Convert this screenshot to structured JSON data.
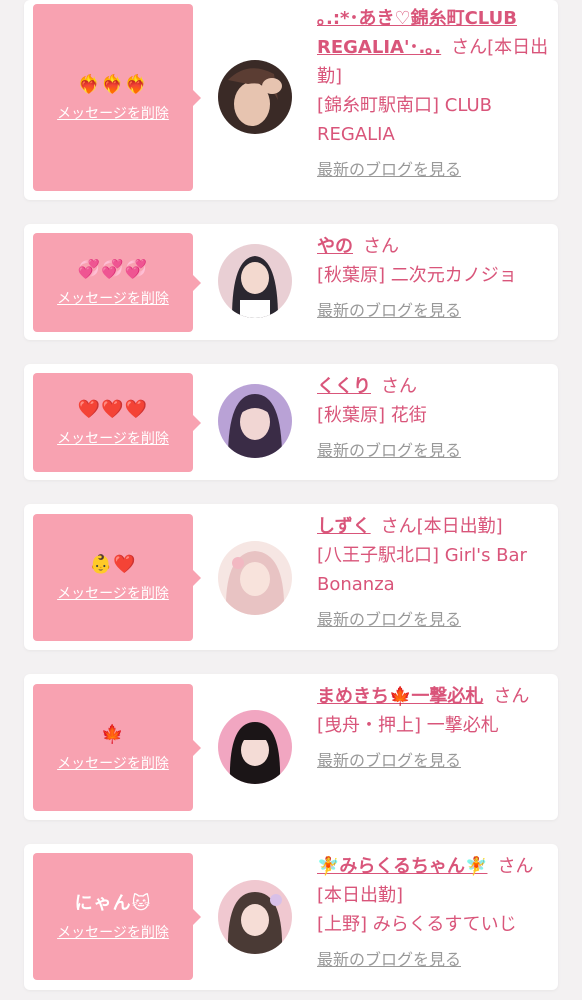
{
  "delete_label": "メッセージを削除",
  "blog_label": "最新のブログを見る",
  "cards": [
    {
      "message": "❤️‍🔥❤️‍🔥❤️‍🔥",
      "name": "｡.:*･あき♡錦糸町CLUB REGALIA'･.｡.",
      "san": "さん",
      "status": "[本日出勤]",
      "shop": "[錦糸町駅南口] CLUB REGALIA",
      "avatar_colors": [
        "#3a2a26",
        "#d9b59e"
      ]
    },
    {
      "message": "💞💞💞",
      "name": "やの",
      "san": "さん",
      "status": "",
      "shop": "[秋葉原] 二次元カノジョ",
      "avatar_colors": [
        "#2b2730",
        "#e9cfd4"
      ]
    },
    {
      "message": "❤️❤️❤️",
      "name": "くくり",
      "san": "さん",
      "status": "",
      "shop": "[秋葉原] 花街",
      "avatar_colors": [
        "#3a2c46",
        "#b9a2d6"
      ]
    },
    {
      "message": "👶❤️",
      "name": "しずく",
      "san": "さん",
      "status": "[本日出勤]",
      "shop": "[八王子駅北口] Girl's Bar Bonanza",
      "avatar_colors": [
        "#e8c3c3",
        "#f6e6e3"
      ]
    },
    {
      "message": "🍁",
      "name": "まめきち🍁一撃必札",
      "san": "さん",
      "status": "",
      "shop": "[曳舟・押上] 一撃必札",
      "avatar_colors": [
        "#1b1517",
        "#f1a6c1"
      ]
    },
    {
      "message": "にゃん🐱",
      "name": "🧚みらくるちゃん🧚",
      "san": "さん",
      "status": "[本日出勤]",
      "shop": "[上野] みらくるすていじ",
      "avatar_colors": [
        "#4a3a35",
        "#f0c8d0"
      ]
    }
  ]
}
